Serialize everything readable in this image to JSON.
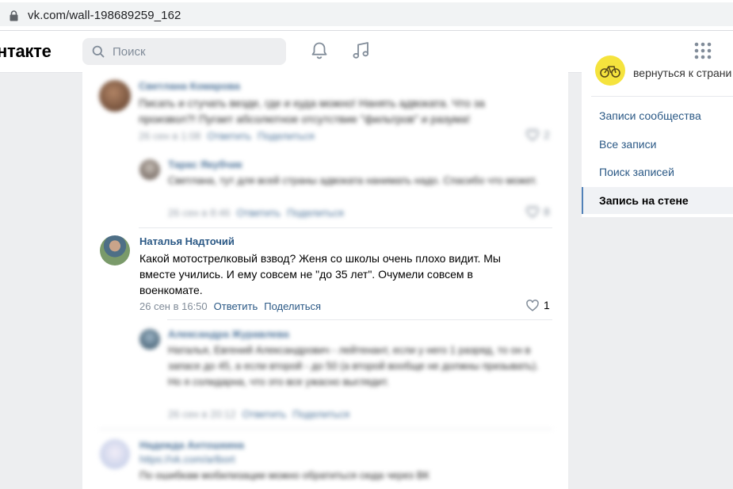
{
  "browser": {
    "url": "vk.com/wall-198689259_162"
  },
  "header": {
    "logo_text": "нтакте",
    "search_placeholder": "Поиск",
    "icons": [
      "search-icon",
      "bell-icon",
      "music-icon",
      "apps-grid-icon"
    ]
  },
  "right_nav": {
    "back_label": "вернуться к страни",
    "items": [
      {
        "label": "Записи сообщества",
        "active": false
      },
      {
        "label": "Все записи",
        "active": false
      },
      {
        "label": "Поиск записей",
        "active": false
      },
      {
        "label": "Запись на стене",
        "active": true
      }
    ]
  },
  "comments": [
    {
      "author": "Светлана Комарова",
      "text": "Писать и стучать везде, где и куда можно! Нанять адвоката. Что за произвол?! Пугает абсолютное отсутствие \"фильтров\" и разума!",
      "date": "26 сен в 1:08",
      "reply": "Ответить",
      "share": "Поделиться",
      "likes": "2"
    },
    {
      "author": "Тарас Якубчик",
      "text": "Светлана, тут для всей страны адвоката нанимать надо. Спасибо что может.",
      "date": "26 сен в 8:46",
      "reply": "Ответить",
      "share": "Поделиться",
      "likes": "8"
    },
    {
      "author": "Наталья Надточий",
      "text": "Какой мотострелковый взвод? Женя со школы очень плохо видит. Мы вместе учились. И ему совсем не \"до 35 лет\". Очумели совсем в военкомате.",
      "date": "26 сен в 16:50",
      "reply": "Ответить",
      "share": "Поделиться",
      "likes": "1"
    },
    {
      "author": "Александра Журавлева",
      "text": "Наталья, Евгений Александрович - лейтенант, если у него 1 разряд, то он в запасе до 45, а если второй - до 50 (а второй вообще не должны призывать). Но я солидарна, что это все ужасно выглядит.",
      "date": "26 сен в 20:12",
      "reply": "Ответить",
      "share": "Поделиться",
      "likes": ""
    },
    {
      "author": "Надежда Антошкина",
      "link": "https://vk.com/arlbort",
      "text": "По ошибкам мобилизации можно обратиться сюда через ВК"
    }
  ]
}
